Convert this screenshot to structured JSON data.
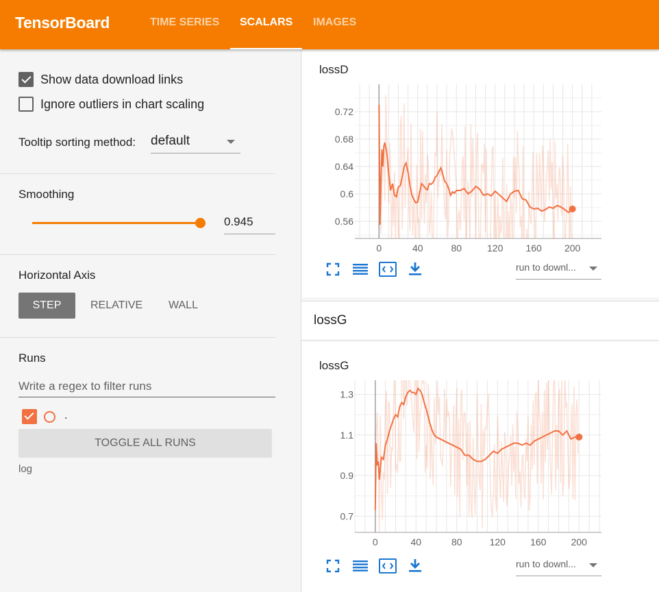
{
  "header": {
    "brand": "TensorBoard",
    "tabs": [
      "TIME SERIES",
      "SCALARS",
      "IMAGES"
    ],
    "active_tab": "SCALARS",
    "color": "#f57c00"
  },
  "sidebar": {
    "show_download_links": {
      "label": "Show data download links",
      "checked": true
    },
    "ignore_outliers": {
      "label": "Ignore outliers in chart scaling",
      "checked": false
    },
    "tooltip": {
      "label": "Tooltip sorting method:",
      "value": "default"
    },
    "smoothing": {
      "title": "Smoothing",
      "value": "0.945"
    },
    "horizontal_axis": {
      "title": "Horizontal Axis",
      "options": [
        "STEP",
        "RELATIVE",
        "WALL"
      ],
      "selected": "STEP"
    },
    "runs": {
      "title": "Runs",
      "filter_placeholder": "Write a regex to filter runs",
      "items": [
        {
          "name": ".",
          "checked": true,
          "color": "#f27142"
        }
      ],
      "toggle_label": "TOGGLE ALL RUNS",
      "log_dir": "log"
    }
  },
  "main": {
    "charts": [
      {
        "title": "lossD",
        "run_select": "run to downl...",
        "icons": [
          "fit-screen-icon",
          "data-table-icon",
          "expand-domain-icon",
          "download-icon"
        ]
      },
      {
        "group_title": "lossG",
        "title": "lossG",
        "run_select": "run to downl...",
        "icons": [
          "fit-screen-icon",
          "data-table-icon",
          "expand-domain-icon",
          "download-icon"
        ]
      }
    ]
  },
  "chart_data": [
    {
      "type": "line",
      "title": "lossD",
      "xlabel": "",
      "ylabel": "",
      "xlim": [
        -25,
        230
      ],
      "ylim": [
        0.535,
        0.76
      ],
      "x_ticks": [
        "0",
        "40",
        "80",
        "120",
        "160",
        "200"
      ],
      "y_ticks": [
        "0.56",
        "0.6",
        "0.64",
        "0.68",
        "0.72"
      ],
      "grid": true,
      "series": [
        {
          "x": [
            0,
            1,
            2,
            3,
            4,
            5,
            6,
            8,
            10,
            12,
            14,
            16,
            18,
            20,
            22,
            24,
            26,
            28,
            30,
            32,
            34,
            36,
            38,
            40,
            42,
            44,
            46,
            48,
            50,
            52,
            54,
            56,
            58,
            60,
            62,
            64,
            66,
            68,
            70,
            72,
            74,
            76,
            78,
            80,
            84,
            88,
            92,
            96,
            100,
            104,
            108,
            112,
            116,
            120,
            124,
            128,
            132,
            136,
            140,
            144,
            148,
            152,
            156,
            160,
            164,
            168,
            172,
            176,
            180,
            184,
            188,
            192,
            196,
            200
          ],
          "y": [
            0.73,
            0.555,
            0.62,
            0.665,
            0.64,
            0.67,
            0.675,
            0.66,
            0.63,
            0.605,
            0.615,
            0.598,
            0.596,
            0.61,
            0.612,
            0.625,
            0.64,
            0.645,
            0.632,
            0.612,
            0.598,
            0.592,
            0.587,
            0.588,
            0.602,
            0.615,
            0.612,
            0.608,
            0.606,
            0.615,
            0.614,
            0.617,
            0.624,
            0.627,
            0.633,
            0.638,
            0.628,
            0.618,
            0.615,
            0.608,
            0.598,
            0.603,
            0.601,
            0.605,
            0.605,
            0.608,
            0.6,
            0.604,
            0.611,
            0.607,
            0.598,
            0.6,
            0.597,
            0.604,
            0.599,
            0.594,
            0.589,
            0.6,
            0.604,
            0.605,
            0.593,
            0.591,
            0.581,
            0.578,
            0.579,
            0.575,
            0.577,
            0.581,
            0.579,
            0.583,
            0.581,
            0.577,
            0.573,
            0.578
          ]
        }
      ]
    },
    {
      "type": "line",
      "title": "lossG",
      "xlabel": "",
      "ylabel": "",
      "xlim": [
        -20,
        222
      ],
      "ylim": [
        0.62,
        1.37
      ],
      "x_ticks": [
        "0",
        "40",
        "80",
        "120",
        "160",
        "200"
      ],
      "y_ticks": [
        "0.7",
        "0.9",
        "1.1",
        "1.3"
      ],
      "grid": true,
      "series": [
        {
          "x": [
            0,
            1,
            2,
            3,
            4,
            6,
            8,
            10,
            12,
            14,
            16,
            18,
            20,
            22,
            24,
            26,
            28,
            30,
            32,
            34,
            36,
            38,
            40,
            42,
            44,
            46,
            48,
            50,
            52,
            54,
            56,
            58,
            60,
            64,
            68,
            72,
            76,
            80,
            84,
            88,
            92,
            96,
            100,
            104,
            108,
            112,
            116,
            120,
            124,
            128,
            132,
            136,
            140,
            144,
            148,
            152,
            156,
            160,
            164,
            168,
            172,
            176,
            180,
            184,
            188,
            192,
            196,
            200
          ],
          "y": [
            0.73,
            1.06,
            0.95,
            0.97,
            0.88,
            0.99,
            0.98,
            1.05,
            1.08,
            1.12,
            1.15,
            1.18,
            1.2,
            1.19,
            1.24,
            1.26,
            1.25,
            1.29,
            1.31,
            1.32,
            1.31,
            1.31,
            1.3,
            1.33,
            1.32,
            1.3,
            1.26,
            1.23,
            1.19,
            1.15,
            1.12,
            1.1,
            1.09,
            1.08,
            1.07,
            1.06,
            1.05,
            1.04,
            1.03,
            1.0,
            1.0,
            0.98,
            0.97,
            0.97,
            0.98,
            1.0,
            1.02,
            1.01,
            1.03,
            1.04,
            1.05,
            1.06,
            1.06,
            1.05,
            1.06,
            1.05,
            1.07,
            1.08,
            1.09,
            1.1,
            1.11,
            1.12,
            1.12,
            1.1,
            1.12,
            1.08,
            1.09,
            1.09
          ]
        }
      ]
    }
  ]
}
